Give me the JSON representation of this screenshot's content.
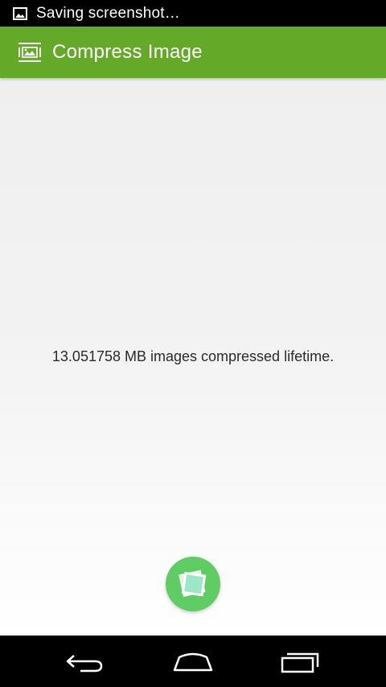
{
  "status_bar": {
    "notification_icon": "image-icon",
    "text": "Saving screenshot…"
  },
  "action_bar": {
    "app_icon": "compress-image-icon",
    "title": "Compress Image",
    "color": "#65a928"
  },
  "main": {
    "lifetime_text": "13.051758 MB images compressed lifetime.",
    "fab": {
      "icon": "pick-image-icon",
      "color": "#5fcc64"
    }
  },
  "nav_bar": {
    "buttons": [
      "back-icon",
      "home-icon",
      "recents-icon"
    ]
  }
}
